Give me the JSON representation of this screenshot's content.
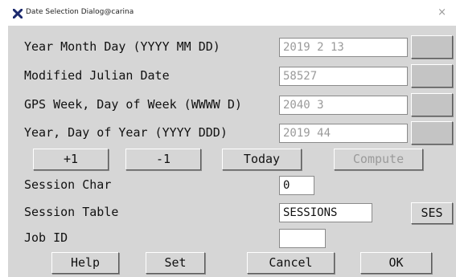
{
  "window": {
    "title": "Date Selection Dialog@carina",
    "close_glyph": "×",
    "app_icon": "x-logo-icon"
  },
  "date_rows": [
    {
      "label": "Year Month Day (YYYY MM DD)",
      "value": "2019 2 13"
    },
    {
      "label": "Modified Julian Date",
      "value": "58527"
    },
    {
      "label": "GPS Week, Day of Week (WWWW D)",
      "value": "2040 3"
    },
    {
      "label": "Year, Day of Year (YYYY DDD)",
      "value": "2019 44"
    }
  ],
  "step_buttons": {
    "plus_one": "+1",
    "minus_one": "-1",
    "today": "Today",
    "compute": "Compute"
  },
  "session_char": {
    "label": "Session Char",
    "value": "0"
  },
  "session_table": {
    "label": "Session Table",
    "value": "SESSIONS",
    "button": "SES"
  },
  "job_id": {
    "label": "Job ID",
    "value": ""
  },
  "footer_buttons": {
    "help": "Help",
    "set": "Set",
    "cancel": "Cancel",
    "ok": "OK"
  },
  "colors": {
    "dialog_bg": "#d6d6d6",
    "muted_text": "#9a9a9a",
    "icon_blue": "#1c2a6e"
  }
}
